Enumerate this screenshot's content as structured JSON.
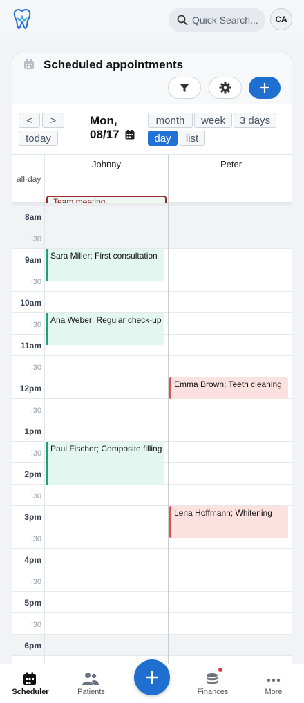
{
  "header": {
    "search_placeholder": "Quick Search...",
    "avatar_initials": "CA"
  },
  "card": {
    "title": "Scheduled appointments"
  },
  "toolbar": {
    "prev": "<",
    "next": ">",
    "today": "today",
    "date_line1": "Mon,",
    "date_line2": "08/17",
    "views": {
      "month": "month",
      "week": "week",
      "three_days": "3 days",
      "day": "day",
      "list": "list"
    },
    "active_view": "day"
  },
  "calendar": {
    "resources": [
      "Johnny",
      "Peter"
    ],
    "allday_label": "all-day",
    "allday_event": "Team meeting",
    "times": [
      {
        "label": "8am",
        "hour": true
      },
      {
        "label": ":30",
        "hour": false
      },
      {
        "label": "9am",
        "hour": true
      },
      {
        "label": ":30",
        "hour": false
      },
      {
        "label": "10am",
        "hour": true
      },
      {
        "label": ":30",
        "hour": false
      },
      {
        "label": "11am",
        "hour": true
      },
      {
        "label": ":30",
        "hour": false
      },
      {
        "label": "12pm",
        "hour": true
      },
      {
        "label": ":30",
        "hour": false
      },
      {
        "label": "1pm",
        "hour": true
      },
      {
        "label": ":30",
        "hour": false
      },
      {
        "label": "2pm",
        "hour": true
      },
      {
        "label": ":30",
        "hour": false
      },
      {
        "label": "3pm",
        "hour": true
      },
      {
        "label": ":30",
        "hour": false
      },
      {
        "label": "4pm",
        "hour": true
      },
      {
        "label": ":30",
        "hour": false
      },
      {
        "label": "5pm",
        "hour": true
      },
      {
        "label": ":30",
        "hour": false
      },
      {
        "label": "6pm",
        "hour": true
      }
    ],
    "events": [
      {
        "text": "Sara Miller; First consultation",
        "resource": "Johnny",
        "start": "9:00",
        "end": "9:45",
        "color": "green"
      },
      {
        "text": "Ana Weber; Regular check-up",
        "resource": "Johnny",
        "start": "10:30",
        "end": "11:15",
        "color": "green"
      },
      {
        "text": "Emma Brown; Teeth cleaning",
        "resource": "Peter",
        "start": "12:00",
        "end": "12:30",
        "color": "red"
      },
      {
        "text": "Paul Fischer; Composite filling",
        "resource": "Johnny",
        "start": "1:30",
        "end": "2:30",
        "color": "green"
      },
      {
        "text": "Lena Hoffmann; Whitening",
        "resource": "Peter",
        "start": "3:00",
        "end": "3:45",
        "color": "red"
      }
    ]
  },
  "nav": {
    "scheduler": "Scheduler",
    "patients": "Patients",
    "finances": "Finances",
    "more": "More"
  },
  "colors": {
    "primary": "#1f6fd1",
    "event_green_bg": "#e3f6ef",
    "event_green_border": "#1ea07a",
    "event_red_bg": "#fbe2e0",
    "event_red_border": "#d9534f"
  }
}
